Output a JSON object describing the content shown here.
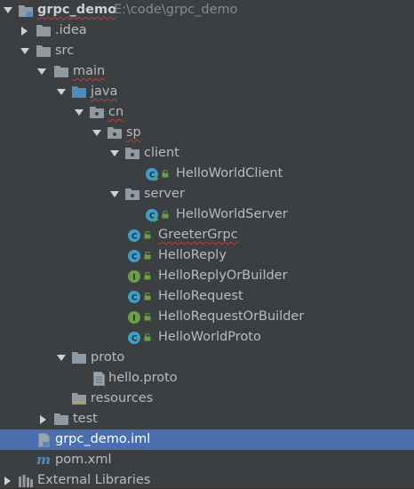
{
  "project": {
    "name": "grpc_demo",
    "path": "E:\\code\\grpc_demo"
  },
  "tree": {
    "idea": ".idea",
    "src": "src",
    "main": "main",
    "java": "java",
    "cn": "cn",
    "sp": "sp",
    "client": "client",
    "hello_world_client": "HelloWorldClient",
    "server": "server",
    "hello_world_server": "HelloWorldServer",
    "greeter_grpc": "GreeterGrpc",
    "hello_reply": "HelloReply",
    "hello_reply_or_builder": "HelloReplyOrBuilder",
    "hello_request": "HelloRequest",
    "hello_request_or_builder": "HelloRequestOrBuilder",
    "hello_world_proto": "HelloWorldProto",
    "proto": "proto",
    "hello_proto": "hello.proto",
    "resources": "resources",
    "test": "test",
    "iml": "grpc_demo.iml",
    "pom": "pom.xml",
    "external_libraries": "External Libraries"
  },
  "icons": {
    "module": "module-folder-icon",
    "folder": "folder-icon",
    "source_root": "source-root-icon",
    "package": "package-icon",
    "class": "class-icon",
    "interface": "interface-icon",
    "file": "file-icon",
    "maven": "maven-icon",
    "libraries": "libraries-icon"
  },
  "colors": {
    "background": "#3c3f41",
    "selection": "#4b6eaf",
    "text": "#bbbbbb",
    "path_text": "#8a8a8a",
    "class_icon": "#3d9ec9",
    "interface_icon": "#6a9f47",
    "runnable_badge": "#57a64a",
    "error_underline": "#bc3f3c",
    "folder": "#8f9aa3",
    "source_folder": "#4f8bbd"
  }
}
